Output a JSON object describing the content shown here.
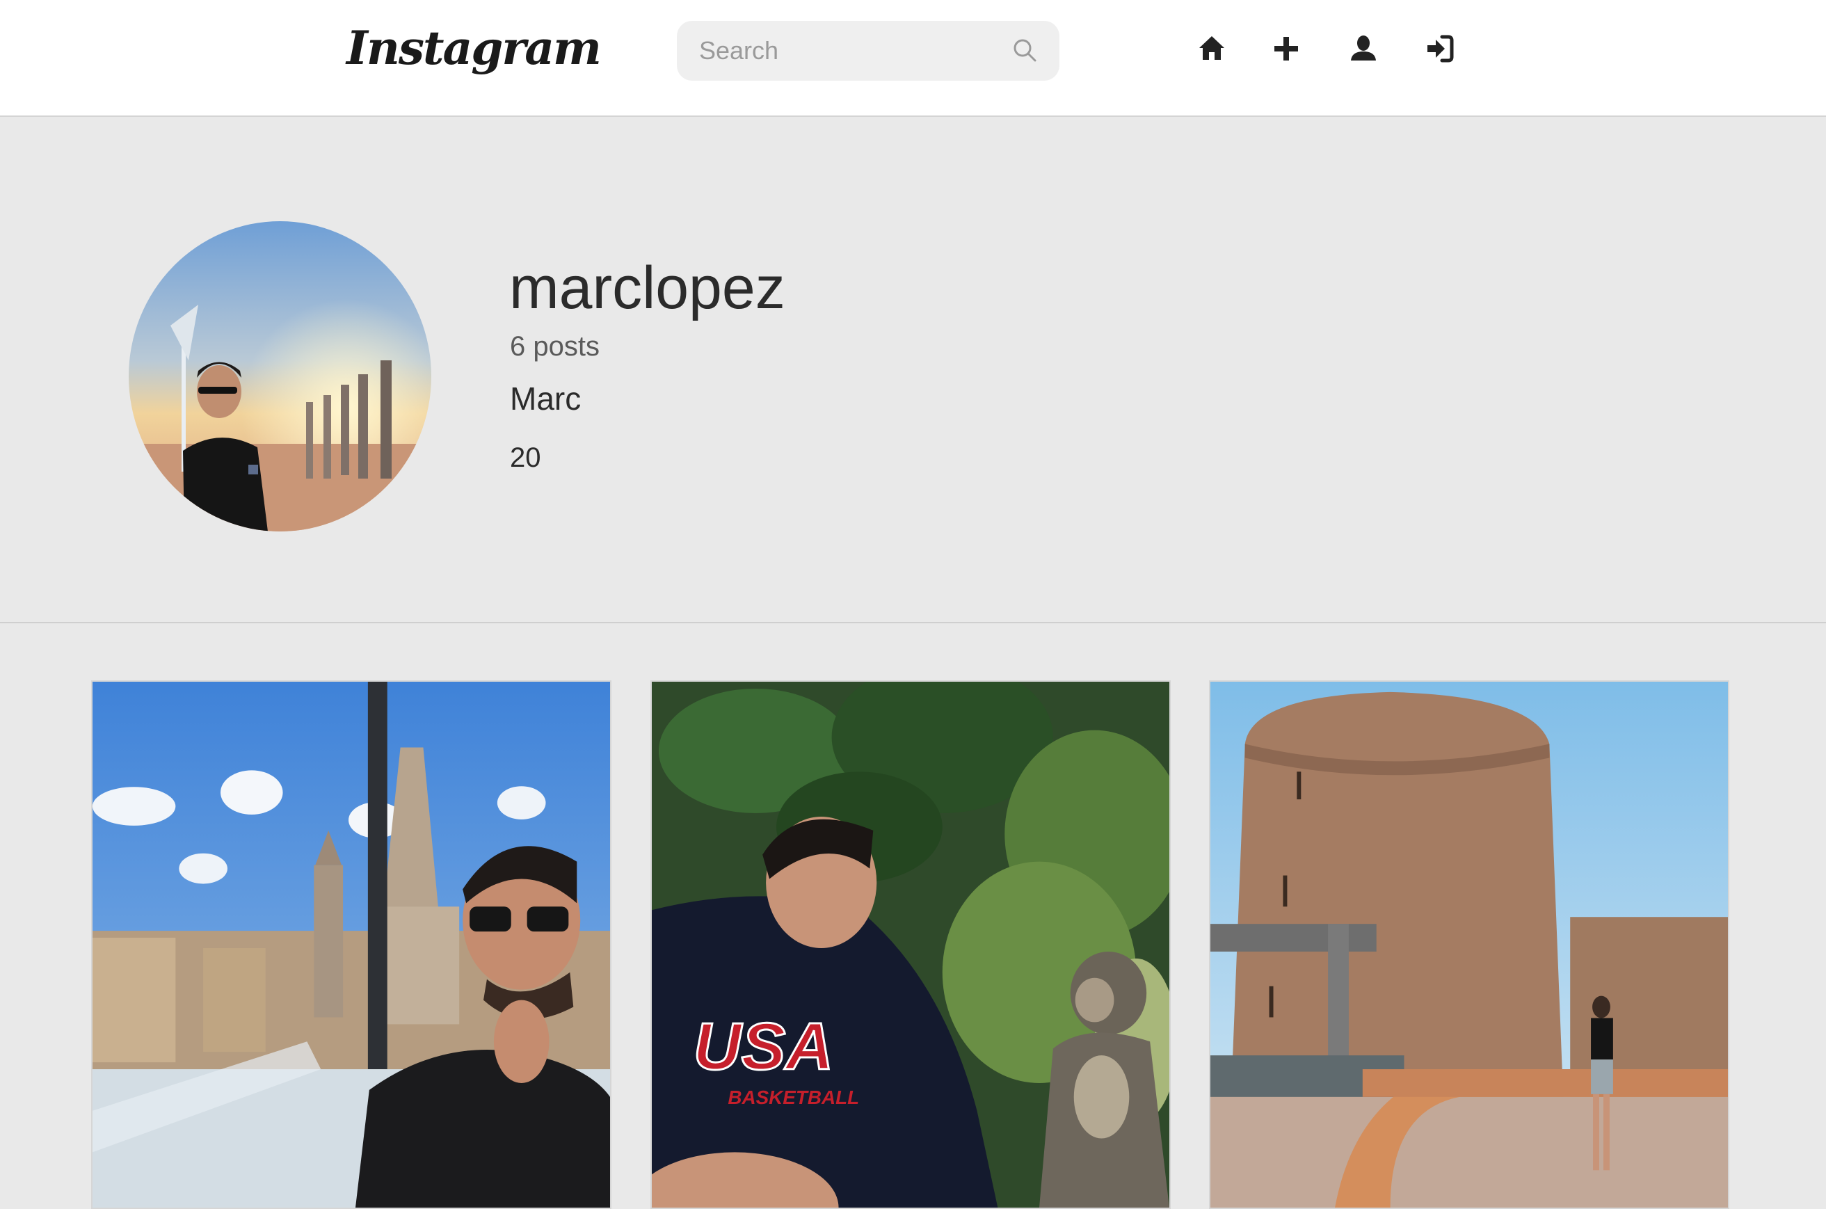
{
  "header": {
    "logo_text": "Instagram",
    "search": {
      "placeholder": "Search",
      "value": ""
    },
    "nav": [
      {
        "icon": "home-icon"
      },
      {
        "icon": "plus-icon"
      },
      {
        "icon": "user-icon"
      },
      {
        "icon": "login-icon"
      }
    ]
  },
  "profile": {
    "username": "marclopez",
    "posts_count": "6 posts",
    "full_name": "Marc",
    "bio": "20"
  },
  "posts": [
    {
      "id": "post-1"
    },
    {
      "id": "post-2"
    },
    {
      "id": "post-3"
    }
  ],
  "colors": {
    "page_bg": "#e9e9e9",
    "topbar_bg": "#ffffff",
    "search_bg": "#efefef",
    "text_primary": "#2b2b2b",
    "text_secondary": "#5a5a5a"
  }
}
